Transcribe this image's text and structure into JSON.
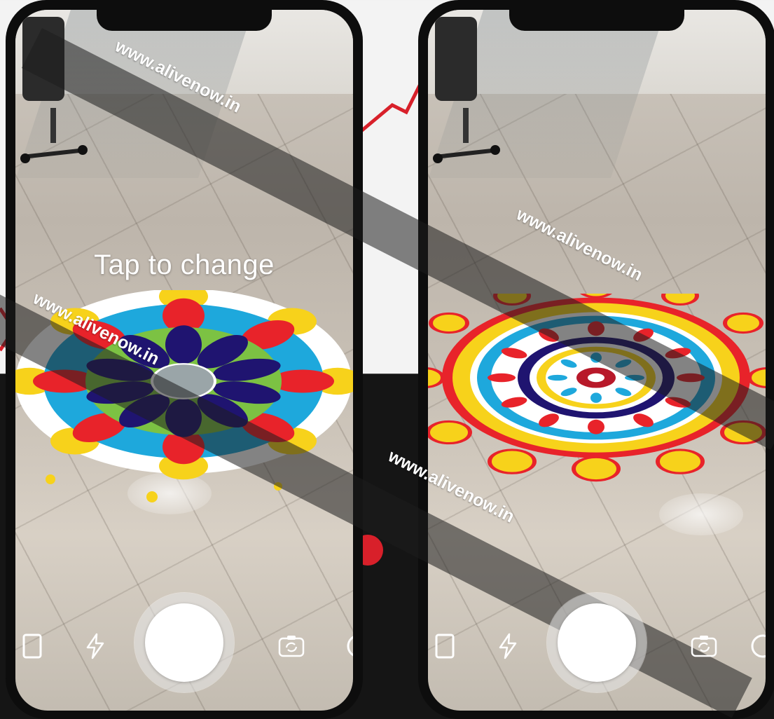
{
  "screens": [
    {
      "id": "left",
      "prompt_text": "Tap to change",
      "watermarks": [
        "www.alivenow.in",
        "www.alivenow.in"
      ]
    },
    {
      "id": "right",
      "prompt_text": "",
      "watermarks": [
        "www.alivenow.in",
        "www.alivenow.in"
      ]
    }
  ],
  "colors": {
    "accent_red": "#d8202a",
    "rangoli_navy": "#1f1470",
    "rangoli_cyan": "#1ea8dc",
    "rangoli_yellow": "#f7d21b",
    "rangoli_green": "#7cc243"
  },
  "icons": [
    "gallery-icon",
    "flash-icon",
    "shutter-button",
    "switch-camera-icon",
    "lens-icon"
  ]
}
